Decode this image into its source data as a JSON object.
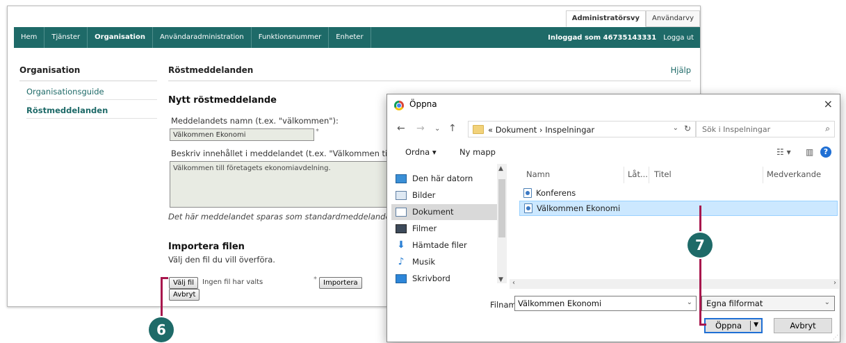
{
  "app": {
    "view_tabs": [
      "Administratörsvy",
      "Användarvy"
    ],
    "nav": {
      "items": [
        "Hem",
        "Tjänster",
        "Organisation",
        "Användaradministration",
        "Funktionsnummer",
        "Enheter"
      ],
      "active": "Organisation",
      "logged_in": "Inloggad som 46735143331",
      "logout": "Logga ut"
    },
    "sidebar": {
      "title": "Organisation",
      "items": [
        "Organisationsguide",
        "Röstmeddelanden"
      ]
    },
    "main": {
      "title": "Röstmeddelanden",
      "help": "Hjälp",
      "section_title": "Nytt röstmeddelande",
      "name_label": "Meddelandets namn (t.ex. \"välkommen\"):",
      "name_value": "Välkommen Ekonomi",
      "required_mark": "*",
      "desc_label": "Beskriv innehållet i meddelandet (t.ex. \"Välkommen til",
      "desc_value": "Välkommen till företagets ekonomiavdelning.",
      "note": "Det här meddelandet sparas som standardmeddelande.",
      "import_title": "Importera filen",
      "import_sub": "Välj den fil du vill överföra.",
      "choose_file": "Välj fil",
      "no_file": "Ingen fil har valts",
      "import_button": "Importera",
      "cancel_button": "Avbryt"
    }
  },
  "callouts": {
    "step6": "6",
    "step7": "7"
  },
  "dialog": {
    "title": "Öppna",
    "close": "×",
    "breadcrumb": [
      "«",
      "Dokument",
      "›",
      "Inspelningar"
    ],
    "search_placeholder": "Sök i Inspelningar",
    "toolbar": {
      "organize": "Ordna ▾",
      "new_folder": "Ny mapp"
    },
    "nav_items": [
      {
        "label": "Den här datorn",
        "icon": "computer-icon"
      },
      {
        "label": "Bilder",
        "icon": "pictures-icon"
      },
      {
        "label": "Dokument",
        "icon": "documents-icon",
        "selected": true
      },
      {
        "label": "Filmer",
        "icon": "videos-icon"
      },
      {
        "label": "Hämtade filer",
        "icon": "downloads-icon"
      },
      {
        "label": "Musik",
        "icon": "music-icon"
      },
      {
        "label": "Skrivbord",
        "icon": "desktop-icon"
      }
    ],
    "columns": [
      "Namn",
      "Låt...",
      "Titel",
      "Medverkande"
    ],
    "files": [
      {
        "name": "Konferens",
        "selected": false
      },
      {
        "name": "Välkommen Ekonomi",
        "selected": true
      }
    ],
    "filename_label": "Filnamn:",
    "filename_value": "Välkommen Ekonomi",
    "filetype_value": "Egna filformat",
    "open_button": "Öppna",
    "cancel_button": "Avbryt"
  },
  "colors": {
    "accent": "#1e6a68",
    "callout_line": "#a8174d",
    "dialog_focus": "#1f6fd4",
    "selection": "#cce8ff"
  }
}
